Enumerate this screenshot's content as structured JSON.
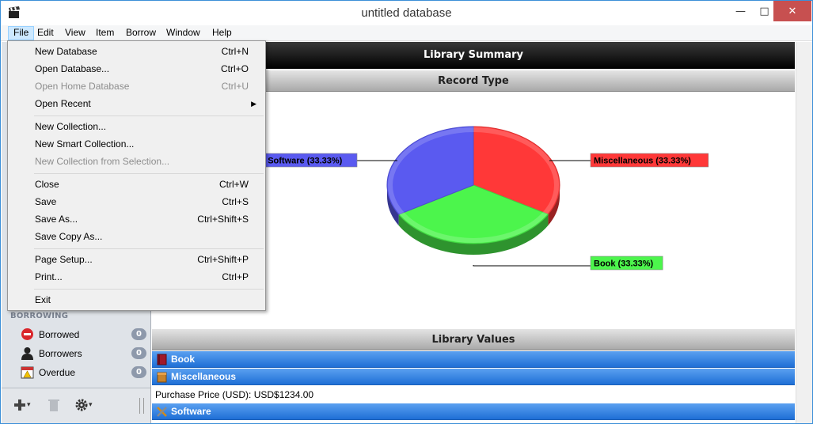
{
  "window": {
    "title": "untitled database"
  },
  "menubar": [
    "File",
    "Edit",
    "View",
    "Item",
    "Borrow",
    "Window",
    "Help"
  ],
  "file_menu": [
    {
      "label": "New Database",
      "shortcut": "Ctrl+N",
      "disabled": false
    },
    {
      "label": "Open Database...",
      "shortcut": "Ctrl+O",
      "disabled": false
    },
    {
      "label": "Open Home Database",
      "shortcut": "Ctrl+U",
      "disabled": true
    },
    {
      "label": "Open Recent",
      "shortcut": "",
      "disabled": false,
      "submenu": true
    },
    {
      "label": "New Collection...",
      "shortcut": "",
      "disabled": false
    },
    {
      "label": "New Smart Collection...",
      "shortcut": "",
      "disabled": false
    },
    {
      "label": "New Collection from Selection...",
      "shortcut": "",
      "disabled": true
    },
    {
      "label": "Close",
      "shortcut": "Ctrl+W",
      "disabled": false
    },
    {
      "label": "Save",
      "shortcut": "Ctrl+S",
      "disabled": false
    },
    {
      "label": "Save As...",
      "shortcut": "Ctrl+Shift+S",
      "disabled": false
    },
    {
      "label": "Save Copy As...",
      "shortcut": "",
      "disabled": false
    },
    {
      "label": "Page Setup...",
      "shortcut": "Ctrl+Shift+P",
      "disabled": false
    },
    {
      "label": "Print...",
      "shortcut": "Ctrl+P",
      "disabled": false
    },
    {
      "label": "Exit",
      "shortcut": "",
      "disabled": false
    }
  ],
  "sidebar": {
    "section": "BORROWING",
    "items": [
      {
        "label": "Borrowed",
        "count": "0",
        "icon": "no-entry-icon"
      },
      {
        "label": "Borrowers",
        "count": "0",
        "icon": "person-icon"
      },
      {
        "label": "Overdue",
        "count": "0",
        "icon": "calendar-warning-icon"
      }
    ]
  },
  "main": {
    "summary_title": "Library Summary",
    "record_type_title": "Record Type",
    "values_title": "Library Values",
    "categories": [
      {
        "label": "Book",
        "icon": "book-icon"
      },
      {
        "label": "Miscellaneous",
        "icon": "box-icon"
      },
      {
        "label": "Software",
        "icon": "tools-icon"
      }
    ],
    "misc_value": "Purchase Price (USD): USD$1234.00"
  },
  "chart_data": {
    "type": "pie",
    "slices": [
      {
        "name": "Software",
        "label": "Software (33.33%)",
        "value": 33.33,
        "color": "#5a5af0"
      },
      {
        "name": "Miscellaneous",
        "label": "Miscellaneous (33.33%)",
        "value": 33.33,
        "color": "#ff3838"
      },
      {
        "name": "Book",
        "label": "Book (33.33%)",
        "value": 33.33,
        "color": "#4cf54c"
      }
    ],
    "style": "3d"
  },
  "colors": {
    "accent": "#1e6fd6",
    "header_black": "#000000"
  }
}
